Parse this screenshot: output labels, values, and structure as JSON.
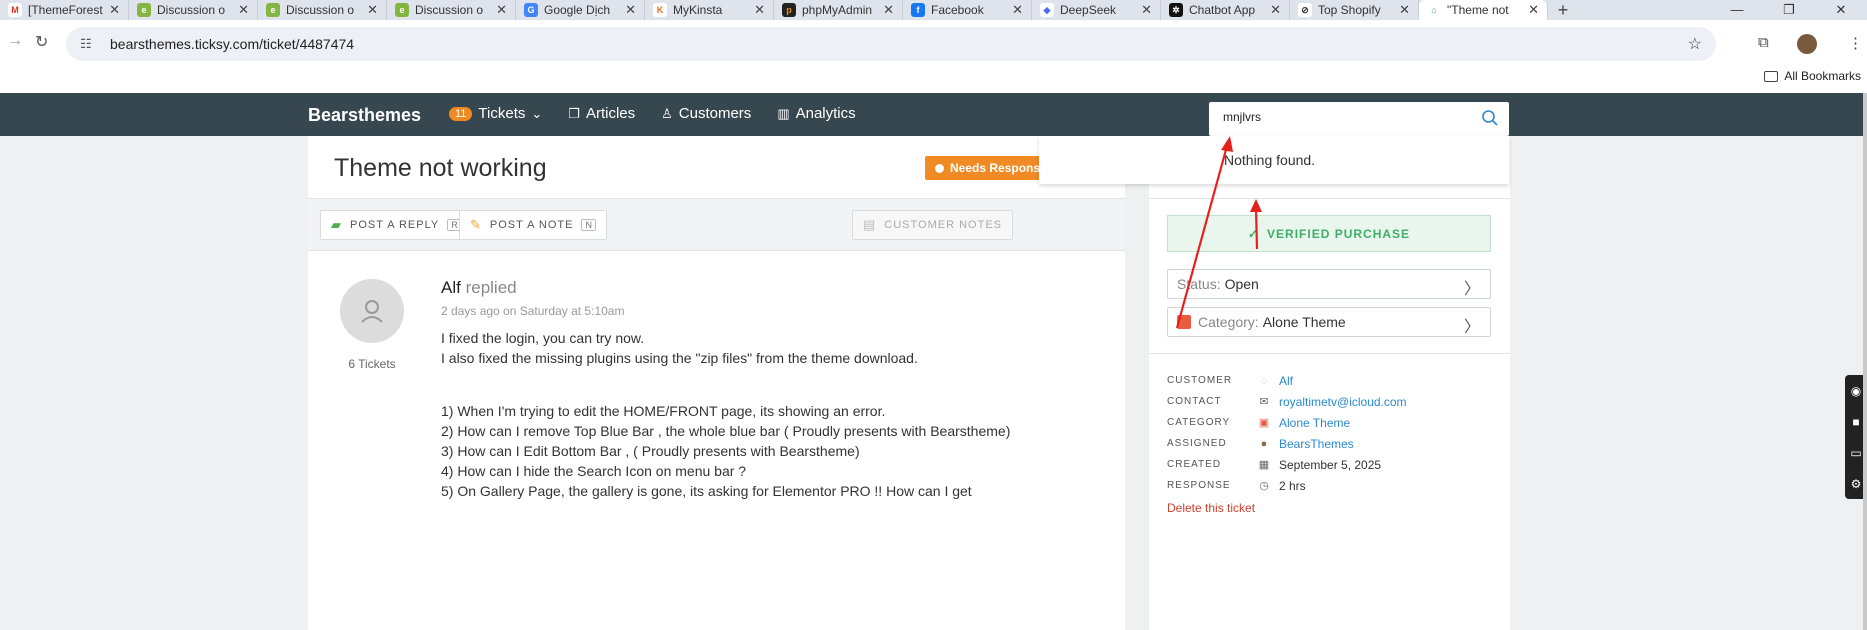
{
  "browser": {
    "tabs": [
      {
        "title": "[ThemeForest",
        "icon": "gmail-icon",
        "color": "#ffffff",
        "glyph": "M",
        "glyphColor": "#d93025"
      },
      {
        "title": "Discussion o",
        "icon": "envato-icon",
        "color": "#82b541",
        "glyph": "e",
        "glyphColor": "#ffffff"
      },
      {
        "title": "Discussion o",
        "icon": "envato-icon",
        "color": "#82b541",
        "glyph": "e",
        "glyphColor": "#ffffff"
      },
      {
        "title": "Discussion o",
        "icon": "envato-icon",
        "color": "#82b541",
        "glyph": "e",
        "glyphColor": "#ffffff"
      },
      {
        "title": "Google Dịch",
        "icon": "google-translate-icon",
        "color": "#4285f4",
        "glyph": "G",
        "glyphColor": "#ffffff"
      },
      {
        "title": "MyKinsta",
        "icon": "kinsta-icon",
        "color": "#ffffff",
        "glyph": "K",
        "glyphColor": "#f36b21"
      },
      {
        "title": "phpMyAdmin",
        "icon": "phpmyadmin-icon",
        "color": "#222222",
        "glyph": "p",
        "glyphColor": "#f29111"
      },
      {
        "title": "Facebook",
        "icon": "facebook-icon",
        "color": "#1877f2",
        "glyph": "f",
        "glyphColor": "#ffffff"
      },
      {
        "title": "DeepSeek",
        "icon": "deepseek-icon",
        "color": "#ffffff",
        "glyph": "◆",
        "glyphColor": "#4d6bfe"
      },
      {
        "title": "Chatbot App",
        "icon": "chatbot-icon",
        "color": "#111111",
        "glyph": "✲",
        "glyphColor": "#ffffff"
      },
      {
        "title": "Top Shopify",
        "icon": "shopify-icon",
        "color": "#ffffff",
        "glyph": "⊘",
        "glyphColor": "#333333"
      },
      {
        "title": "\"Theme not",
        "icon": "ticksy-icon",
        "color": "#ffffff",
        "glyph": "⌂",
        "glyphColor": "#3fae67",
        "active": true
      }
    ],
    "url": "bearsthemes.ticksy.com/ticket/4487474",
    "bookmarks_label": "All Bookmarks"
  },
  "app": {
    "brand": "Bearsthemes",
    "nav": {
      "tickets_count": "11",
      "tickets": "Tickets",
      "articles": "Articles",
      "customers": "Customers",
      "analytics": "Analytics"
    },
    "search": {
      "value": "mnjlvrs",
      "result": "Nothing found."
    }
  },
  "ticket": {
    "title": "Theme not working",
    "status_badge": "Needs Response",
    "actions": {
      "post_reply": "POST A REPLY",
      "post_reply_key": "R",
      "post_note": "POST A NOTE",
      "post_note_key": "N",
      "customer_notes": "CUSTOMER NOTES"
    },
    "reply": {
      "author": "Alf",
      "verb": "replied",
      "time": "2 days ago on Saturday at 5:10am",
      "tickets_count": "6 Tickets",
      "lines_a": [
        "I fixed the login, you can try now.",
        "I also fixed the missing plugins using the \"zip files\" from the theme download."
      ],
      "lines_b": [
        "1) When I'm trying to edit the HOME/FRONT page, its showing an error.",
        "2) How can I remove Top Blue Bar , the whole blue bar ( Proudly presents with Bearstheme)",
        "3) How can I Edit Bottom Bar ,  ( Proudly presents with Bearstheme)",
        "4) How can I hide the Search Icon on menu bar ?",
        "5) On Gallery Page, the gallery is gone, its asking for Elementor PRO !!  How can I get"
      ]
    }
  },
  "sidebar": {
    "verified": "VERIFIED PURCHASE",
    "status_label": "Status:",
    "status_value": "Open",
    "category_label": "Category:",
    "category_value": "Alone Theme",
    "meta": [
      {
        "key": "CUSTOMER",
        "value": "Alf",
        "icon": "user-icon",
        "link": true
      },
      {
        "key": "CONTACT",
        "value": "royaltimetv@icloud.com",
        "icon": "mail-icon",
        "link": true
      },
      {
        "key": "CATEGORY",
        "value": "Alone Theme",
        "icon": "category-icon",
        "link": true
      },
      {
        "key": "ASSIGNED",
        "value": "BearsThemes",
        "icon": "bear-avatar-icon",
        "link": true
      },
      {
        "key": "CREATED",
        "value": "September 5, 2025",
        "icon": "calendar-icon",
        "link": false
      },
      {
        "key": "RESPONSE",
        "value": "2 hrs",
        "icon": "clock-icon",
        "link": false
      }
    ],
    "delete": "Delete this ticket"
  },
  "colors": {
    "appbar": "#37474f",
    "accent_orange": "#f08a24",
    "verified_green": "#3fae67",
    "link_blue": "#2b8ad1",
    "annotation_red": "#e8201c"
  }
}
